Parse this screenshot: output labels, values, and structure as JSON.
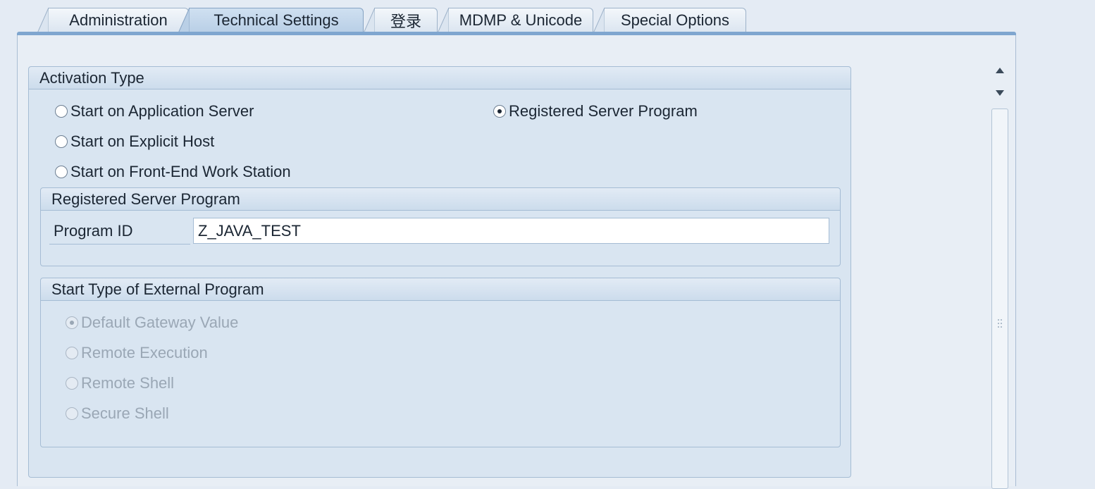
{
  "tabs": [
    {
      "label": "Administration",
      "active": false
    },
    {
      "label": "Technical Settings",
      "active": true
    },
    {
      "label": "登录",
      "active": false
    },
    {
      "label": "MDMP & Unicode",
      "active": false
    },
    {
      "label": "Special Options",
      "active": false
    }
  ],
  "activation": {
    "title": "Activation Type",
    "options": [
      {
        "label": "Start on Application Server",
        "selected": false
      },
      {
        "label": "Registered Server Program",
        "selected": true
      },
      {
        "label": "Start on Explicit Host",
        "selected": false
      },
      {
        "label": "Start on Front-End Work Station",
        "selected": false
      }
    ]
  },
  "registered": {
    "title": "Registered Server Program",
    "program_id_label": "Program ID",
    "program_id_value": "Z_JAVA_TEST"
  },
  "start_type": {
    "title": "Start Type of External Program",
    "options": [
      {
        "label": "Default Gateway Value",
        "selected": true,
        "disabled": true
      },
      {
        "label": "Remote Execution",
        "selected": false,
        "disabled": true
      },
      {
        "label": "Remote Shell",
        "selected": false,
        "disabled": true
      },
      {
        "label": "Secure Shell",
        "selected": false,
        "disabled": true
      }
    ]
  },
  "scrollbar": {
    "up_icon": "triangle-up-icon",
    "down_icon": "triangle-down-icon",
    "grip_icon": "grip-icon"
  }
}
